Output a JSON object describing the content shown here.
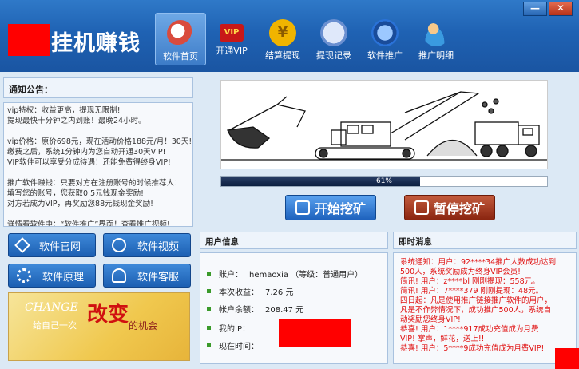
{
  "app": {
    "logo_text": "挂机赚钱",
    "window_buttons": {
      "minimize": "—",
      "close": "✕"
    }
  },
  "nav": [
    {
      "label": "软件首页",
      "icon": "house-icon",
      "color": "#d94b3d"
    },
    {
      "label": "开通VIP",
      "icon": "vip-icon",
      "color": "#c81818"
    },
    {
      "label": "结算提现",
      "icon": "coin-icon",
      "color": "#f0b400"
    },
    {
      "label": "提现记录",
      "icon": "record-icon",
      "color": "#6a8fd0"
    },
    {
      "label": "软件推广",
      "icon": "share-icon",
      "color": "#2a72d8"
    },
    {
      "label": "推广明细",
      "icon": "users-icon",
      "color": "#3a9ae0"
    }
  ],
  "notice": {
    "title": "通知公告：",
    "lines": [
      "vip特权：收益更高，提现无限制!",
      "提现最快十分钟之内到账！最晚24小时。",
      "",
      "vip价格：原价698元，现在活动价格188元/月！30天!",
      "缴费之后，系统1分钟内为您自动开通30天VIP!",
      "VIP软件可以享受分成待遇！还能免费得终身VIP!",
      "",
      "推广软件赚钱：只要对方在注册账号的时候推荐人：",
      "填写您的账号，您获取0.5元钱现金奖励!",
      "对方若成为VIP，再奖励您88元钱现金奖励!",
      "",
      "详情看软件中：“软件推广”界面！查看推广视频!"
    ]
  },
  "left_buttons": {
    "website": "软件官网",
    "video": "软件视频",
    "principle": "软件原理",
    "service": "软件客服"
  },
  "banner": {
    "change": "CHANGE",
    "gaibian": "改变",
    "slogan": "给自己一次",
    "chance": "的机会"
  },
  "progress": {
    "value": 0.61,
    "label": "61%"
  },
  "actions": {
    "start": "开始挖矿",
    "pause": "暂停挖矿"
  },
  "user_info": {
    "title": "用户信息",
    "rows": [
      {
        "label": "账户：",
        "value": "hemaoxia （等级：普通用户）"
      },
      {
        "label": "本次收益：",
        "value": "7.26 元"
      },
      {
        "label": "帐户余额：",
        "value": "208.47 元"
      },
      {
        "label": "我的IP：",
        "value": ""
      },
      {
        "label": "现在时间：",
        "value": ""
      }
    ]
  },
  "messages": {
    "title": "即时消息",
    "lines": [
      "系统通知：用户：92****34推广人数成功达到",
      "500人，系统奖励成为终身VIP会员!",
      "简讯!   用户：z****bl  刚刚提现：558元。",
      "简讯!   用户：7****379  刚刚提现：48元。",
      "四日起：凡是使用推广链接推广软件的用户，",
      "凡是不作弊情况下，成功推广500人，系统自",
      "动奖励您终身VIP!",
      "恭喜!   用户：1****917成功充值成为月费",
      "VIP! 掌声，鲜花，送上!!",
      "恭喜!   用户：5****9成功充值成为月费VIP!"
    ]
  }
}
